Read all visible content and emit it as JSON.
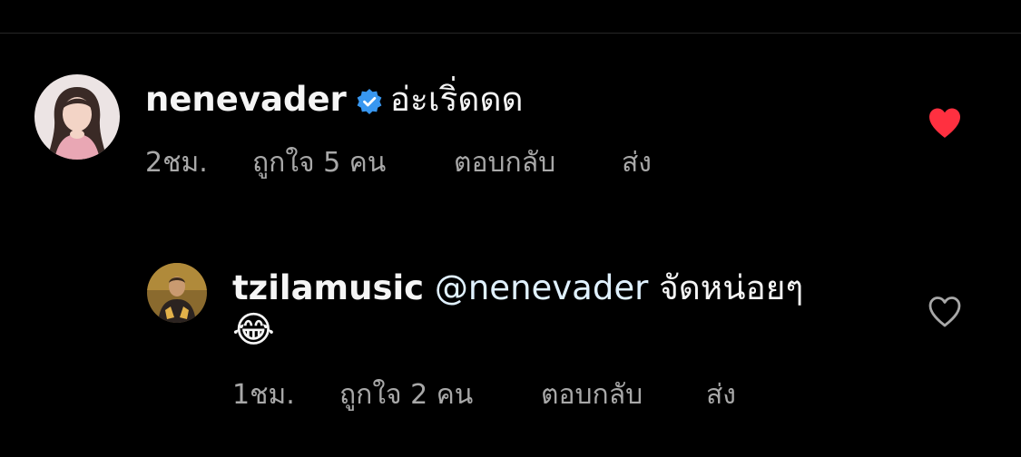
{
  "comments": [
    {
      "username": "nenevader",
      "verified": true,
      "text": "อ่ะเริ่ดดด",
      "time": "2ชม.",
      "likes": "ถูกใจ 5 คน",
      "reply_label": "ตอบกลับ",
      "send_label": "ส่ง",
      "liked": true,
      "heart_icon": "heart-filled-icon",
      "heart_color": "#ff3040"
    },
    {
      "username": "tzilamusic",
      "verified": false,
      "mention": "@nenevader",
      "text": "จัดหน่อยๆ",
      "emoji": "😂",
      "time": "1ชม.",
      "likes": "ถูกใจ 2 คน",
      "reply_label": "ตอบกลับ",
      "send_label": "ส่ง",
      "liked": false,
      "heart_icon": "heart-outline-icon",
      "heart_color": "#a8a8a8"
    }
  ],
  "colors": {
    "background": "#000000",
    "primary_text": "#f5f5f5",
    "secondary_text": "#a8a8a8",
    "verified_badge": "#3897f0",
    "mention": "#e0f1ff"
  }
}
